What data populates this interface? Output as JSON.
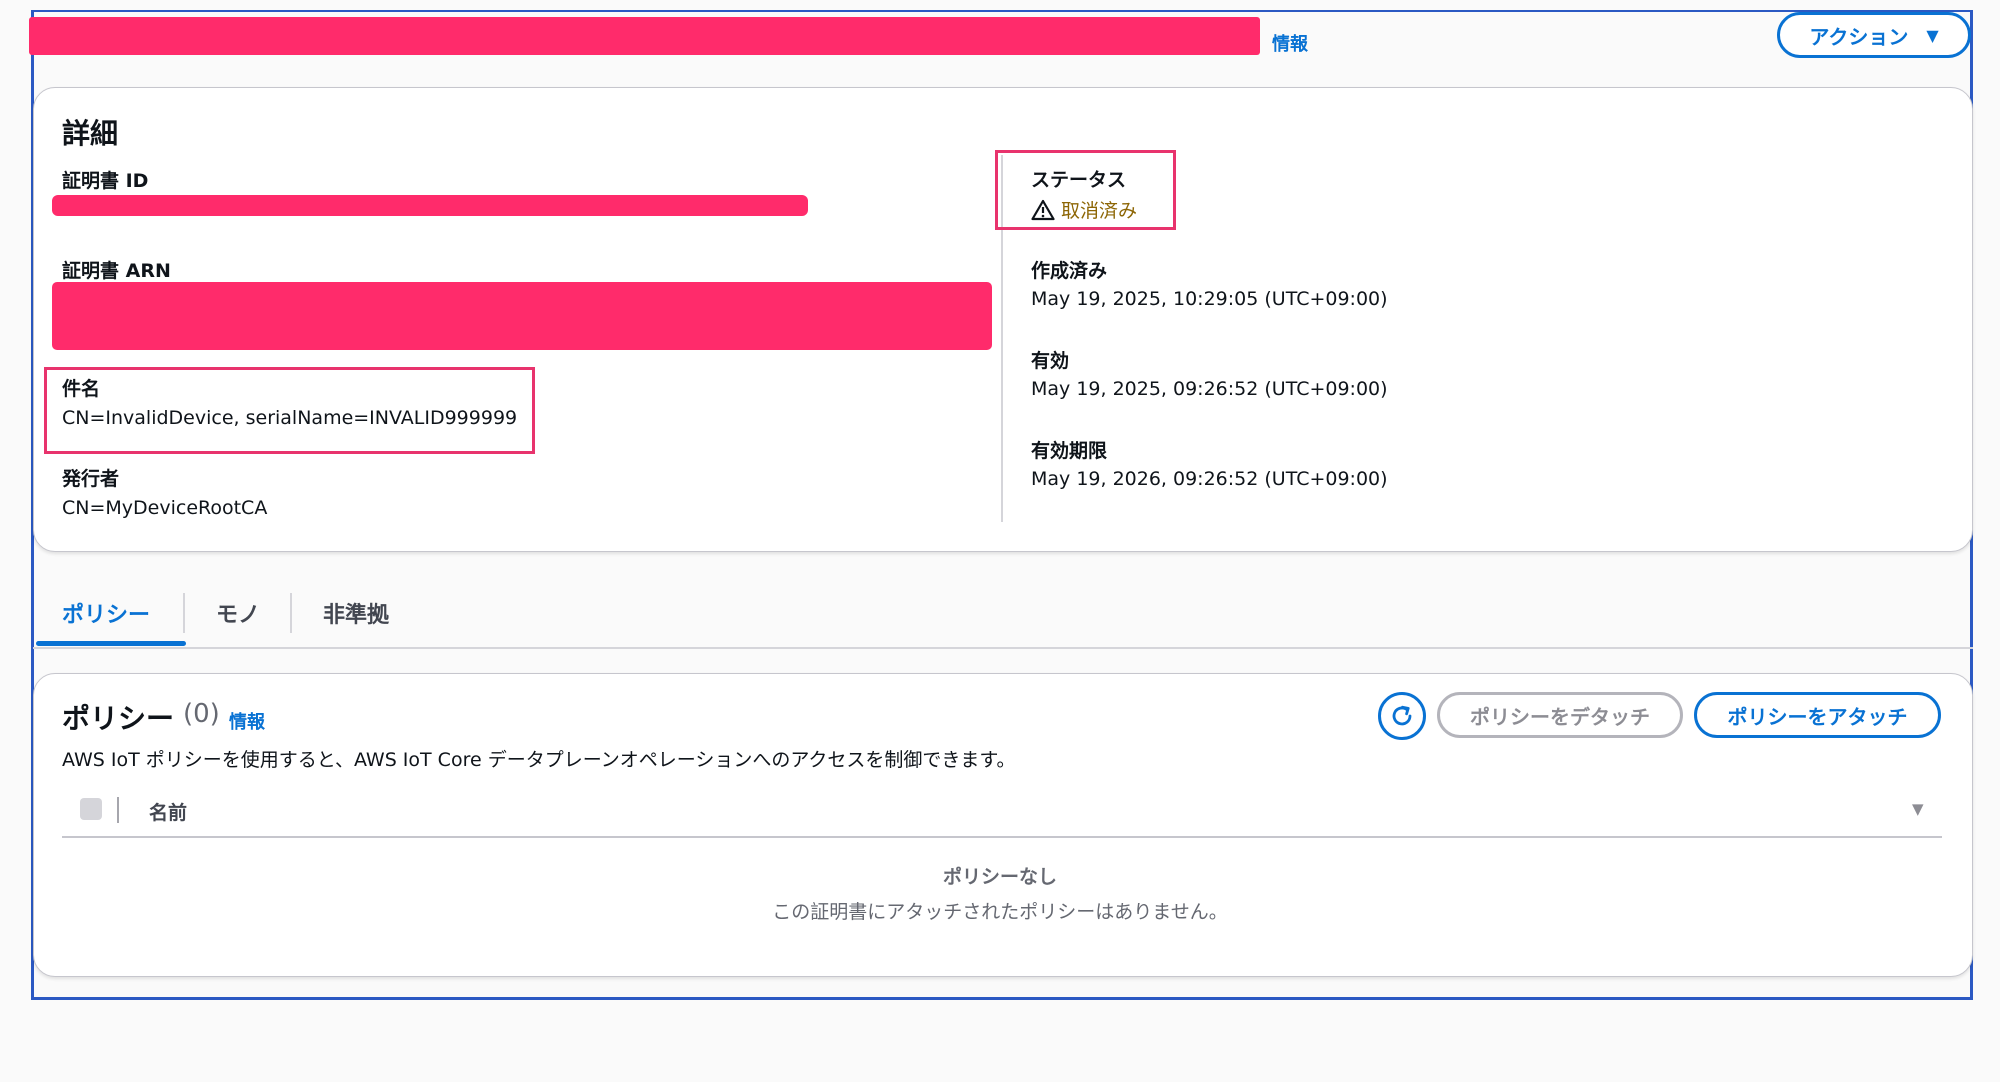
{
  "header": {
    "info_link": "情報",
    "action_button": "アクション"
  },
  "details": {
    "title": "詳細",
    "certificate_id_label": "証明書 ID",
    "certificate_arn_label": "証明書 ARN",
    "subject_label": "件名",
    "subject_value": "CN=InvalidDevice, serialName=INVALID999999",
    "issuer_label": "発行者",
    "issuer_value": "CN=MyDeviceRootCA",
    "status_label": "ステータス",
    "status_value": "取消済み",
    "created_label": "作成済み",
    "created_value": "May 19, 2025, 10:29:05 (UTC+09:00)",
    "valid_label": "有効",
    "valid_value": "May 19, 2025, 09:26:52 (UTC+09:00)",
    "expires_label": "有効期限",
    "expires_value": "May 19, 2026, 09:26:52 (UTC+09:00)"
  },
  "tabs": [
    {
      "label": "ポリシー",
      "active": true
    },
    {
      "label": "モノ",
      "active": false
    },
    {
      "label": "非準拠",
      "active": false
    }
  ],
  "policy": {
    "title": "ポリシー",
    "count": "(0)",
    "info_link": "情報",
    "description": "AWS IoT ポリシーを使用すると、AWS IoT Core データプレーンオペレーションへのアクセスを制御できます。",
    "detach_button": "ポリシーをデタッチ",
    "attach_button": "ポリシーをアタッチ",
    "column_name": "名前",
    "empty_title": "ポリシーなし",
    "empty_description": "この証明書にアタッチされたポリシーはありません。"
  },
  "colors": {
    "accent": "#0972d3",
    "redaction": "#ff2b6b",
    "highlight": "#e8336d",
    "warning": "#8d6605"
  },
  "icons": [
    "warning-icon",
    "refresh-icon",
    "caret-down-icon"
  ]
}
